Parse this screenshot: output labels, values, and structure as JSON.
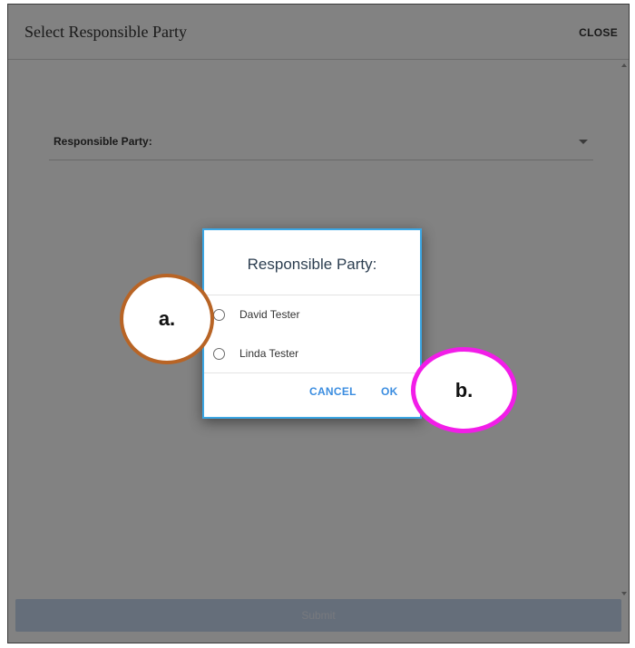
{
  "header": {
    "title": "Select Responsible Party",
    "close_label": "CLOSE"
  },
  "form": {
    "field_label": "Responsible Party:"
  },
  "footer": {
    "submit_label": "Submit"
  },
  "dialog": {
    "title": "Responsible Party:",
    "options": [
      {
        "label": "David Tester",
        "selected": false
      },
      {
        "label": "Linda Tester",
        "selected": false
      }
    ],
    "cancel_label": "CANCEL",
    "ok_label": "OK"
  },
  "annotations": {
    "a": "a.",
    "b": "b."
  },
  "colors": {
    "dialog_border": "#3aa6e4",
    "button_text": "#3b8de0",
    "callout_a_border": "#b86425",
    "callout_b_border": "#f21de8",
    "submit_bg": "#c6d7ef"
  }
}
